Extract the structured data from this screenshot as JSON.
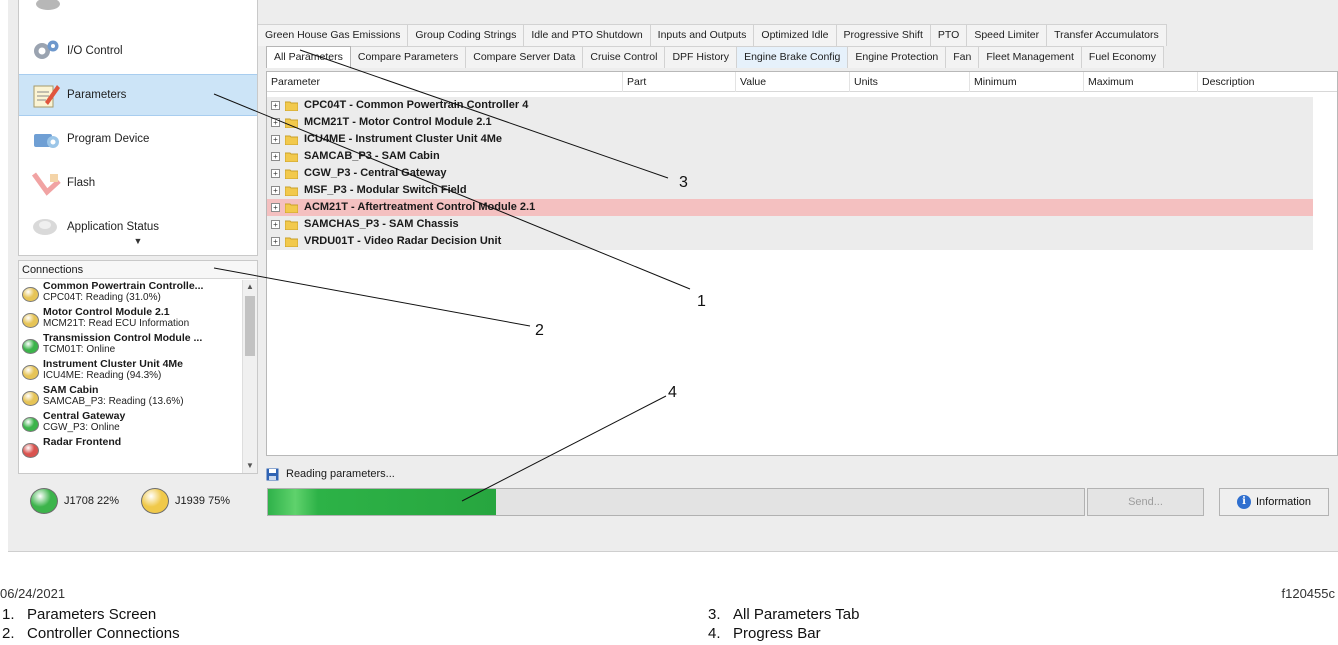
{
  "nav": {
    "items": [
      {
        "label": "I/O Control",
        "icon": "gear-icon"
      },
      {
        "label": "Parameters",
        "icon": "parameters-icon",
        "active": true
      },
      {
        "label": "Program Device",
        "icon": "program-device-icon"
      },
      {
        "label": "Flash",
        "icon": "flash-icon"
      },
      {
        "label": "Application Status",
        "icon": "application-status-icon"
      }
    ]
  },
  "connections": {
    "header": "Connections",
    "items": [
      {
        "name": "Common Powertrain Controlle...",
        "status": "CPC04T: Reading (31.0%)",
        "light": "#e6c457"
      },
      {
        "name": "Motor Control Module 2.1",
        "status": "MCM21T: Read ECU Information",
        "light": "#e6c457"
      },
      {
        "name": "Transmission Control Module ...",
        "status": "TCM01T: Online",
        "light": "#3cb44b"
      },
      {
        "name": "Instrument Cluster Unit 4Me",
        "status": "ICU4ME: Reading (94.3%)",
        "light": "#e6c457"
      },
      {
        "name": "SAM Cabin",
        "status": "SAMCAB_P3: Reading (13.6%)",
        "light": "#e6c457"
      },
      {
        "name": "Central Gateway",
        "status": "CGW_P3: Online",
        "light": "#3cb44b"
      },
      {
        "name": "Radar Frontend",
        "status": "",
        "light": "#d9534f"
      }
    ]
  },
  "bus": {
    "j1708": {
      "label": "J1708 22%",
      "color": "#3cb44b"
    },
    "j1939": {
      "label": "J1939 75%",
      "color": "#f0c94a"
    }
  },
  "tabs": {
    "row1": [
      "Green House Gas Emissions",
      "Group Coding Strings",
      "Idle and PTO Shutdown",
      "Inputs and Outputs",
      "Optimized Idle",
      "Progressive Shift",
      "PTO",
      "Speed Limiter",
      "Transfer Accumulators"
    ],
    "row2": [
      "All Parameters",
      "Compare Parameters",
      "Compare Server Data",
      "Cruise Control",
      "DPF History",
      "Engine Brake Config",
      "Engine Protection",
      "Fan",
      "Fleet Management",
      "Fuel Economy"
    ]
  },
  "grid": {
    "columns": [
      "Parameter",
      "Part",
      "Value",
      "Units",
      "Minimum",
      "Maximum",
      "Description"
    ],
    "rows": [
      {
        "label": "CPC04T - Common Powertrain Controller 4"
      },
      {
        "label": "MCM21T - Motor Control Module 2.1"
      },
      {
        "label": "ICU4ME - Instrument Cluster Unit 4Me"
      },
      {
        "label": "SAMCAB_P3 - SAM Cabin"
      },
      {
        "label": "CGW_P3 - Central Gateway"
      },
      {
        "label": "MSF_P3 - Modular Switch Field"
      },
      {
        "label": "ACM21T - Aftertreatment Control Module 2.1",
        "alarm": true
      },
      {
        "label": "SAMCHAS_P3 - SAM Chassis"
      },
      {
        "label": "VRDU01T - Video Radar Decision Unit"
      }
    ]
  },
  "status": {
    "text": "Reading parameters..."
  },
  "progress": {
    "fraction": 0.28
  },
  "buttons": {
    "send": "Send...",
    "information": "Information"
  },
  "callouts": [
    "3",
    "1",
    "2",
    "4"
  ],
  "footer": {
    "date": "06/24/2021",
    "code": "f120455c"
  },
  "legend": [
    {
      "num": "1.",
      "text": "Parameters Screen"
    },
    {
      "num": "2.",
      "text": "Controller Connections"
    },
    {
      "num": "3.",
      "text": "All Parameters Tab"
    },
    {
      "num": "4.",
      "text": "Progress Bar"
    }
  ]
}
